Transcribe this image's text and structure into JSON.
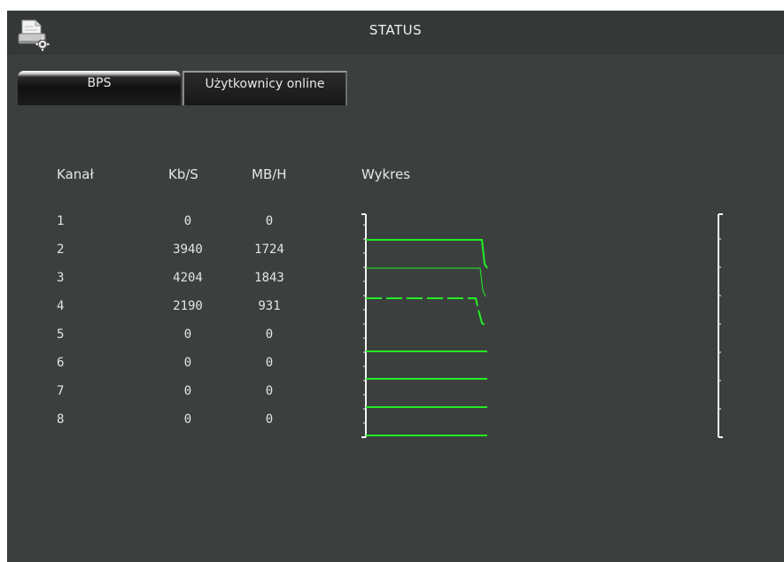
{
  "window": {
    "title": "STATUS",
    "icon": "printer-gear-icon"
  },
  "tabs": [
    {
      "label": "BPS",
      "active": true
    },
    {
      "label": "Użytkownicy online",
      "active": false
    }
  ],
  "table": {
    "headers": [
      "Kanał",
      "Kb/S",
      "MB/H",
      "Wykres"
    ],
    "rows": [
      {
        "channel": "1",
        "kbs": "0",
        "mbh": "0"
      },
      {
        "channel": "2",
        "kbs": "3940",
        "mbh": "1724"
      },
      {
        "channel": "3",
        "kbs": "4204",
        "mbh": "1843"
      },
      {
        "channel": "4",
        "kbs": "2190",
        "mbh": "931"
      },
      {
        "channel": "5",
        "kbs": "0",
        "mbh": "0"
      },
      {
        "channel": "6",
        "kbs": "0",
        "mbh": "0"
      },
      {
        "channel": "7",
        "kbs": "0",
        "mbh": "0"
      },
      {
        "channel": "8",
        "kbs": "0",
        "mbh": "0"
      }
    ]
  },
  "colors": {
    "background": "#3b403f",
    "titlebar": "#343837",
    "graph_line": "#22ee22",
    "text": "#e4e4e4"
  }
}
